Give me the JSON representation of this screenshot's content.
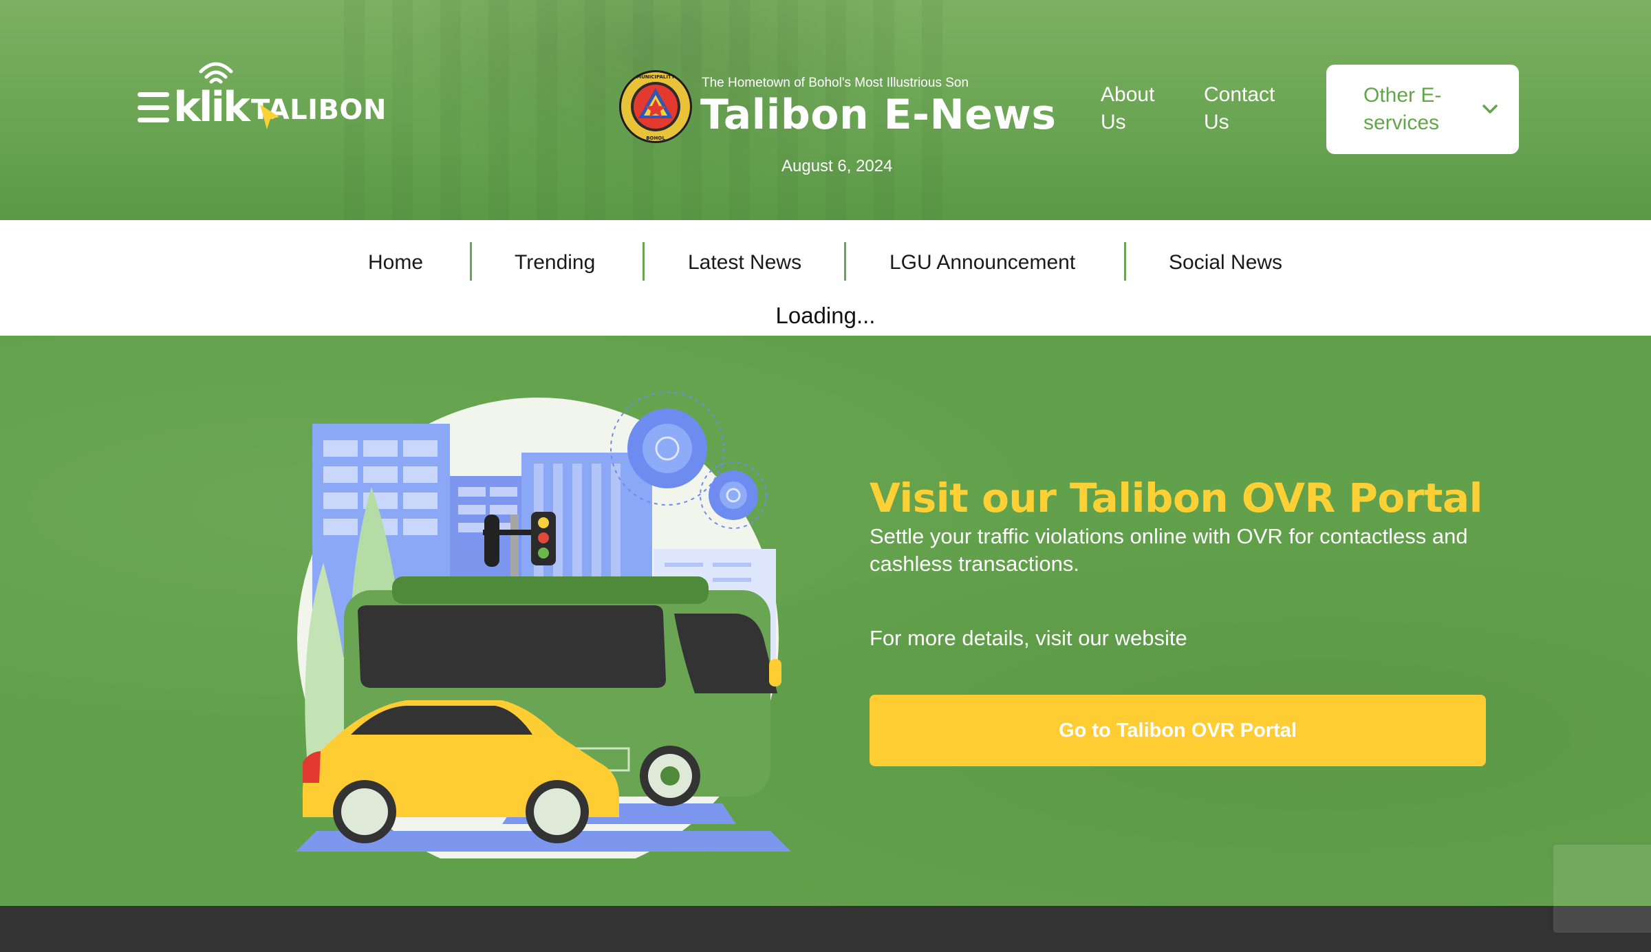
{
  "header": {
    "brand": {
      "prefix": "klik",
      "name": "TALIBON"
    },
    "tagline": "The Hometown of Bohol's Most Illustrious Son",
    "title": "Talibon E-News",
    "date": "August 6, 2024",
    "links": {
      "about": "About Us",
      "contact": "Contact Us"
    },
    "other_services": "Other E-services",
    "seal_text_top": "MUNICIPALITY OF TALIBON",
    "seal_text_bottom": "PROVINCE OF BOHOL"
  },
  "nav": {
    "items": [
      "Home",
      "Trending",
      "Latest News",
      "LGU Announcement",
      "Social News"
    ],
    "status": "Loading..."
  },
  "promo": {
    "title": "Visit our Talibon OVR Portal",
    "description": "Settle your traffic violations online with OVR for contactless and cashless transactions.",
    "more": "For more details, visit our website",
    "button": "Go to Talibon OVR Portal"
  },
  "colors": {
    "brand_green": "#6aa553",
    "accent_yellow": "#fdd135",
    "footer_dark": "#333333"
  },
  "icons": [
    "hamburger-icon",
    "wifi-icon",
    "cursor-icon",
    "municipal-seal",
    "chevron-down-icon"
  ]
}
